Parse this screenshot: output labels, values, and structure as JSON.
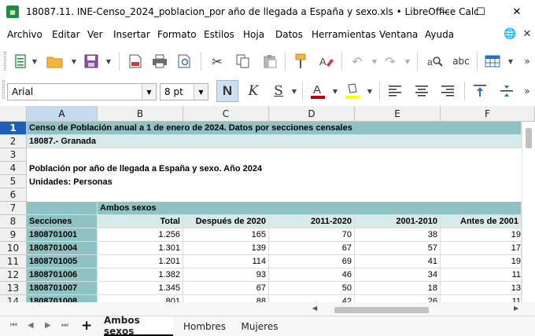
{
  "window": {
    "title": "18087.11. INE-Censo_2024_poblacion_por año de llegada a España y sexo.xls • LibreOffice Calc",
    "app_icon": "calc-app-icon",
    "controls": {
      "minimize": "—",
      "maximize": "☐",
      "close": "✕"
    }
  },
  "menu": {
    "items": [
      "Archivo",
      "Editar",
      "Ver",
      "Insertar",
      "Formato",
      "Estilos",
      "Hoja",
      "Datos",
      "Herramientas",
      "Ventana",
      "Ayuda"
    ],
    "right_icons": [
      "globe-icon",
      "close-document-icon"
    ]
  },
  "toolbar_standard": {
    "icons": [
      "new-spreadsheet-icon",
      "open-folder-icon",
      "save-icon",
      "export-pdf-icon",
      "print-icon",
      "print-preview-icon",
      "cut-icon",
      "copy-icon",
      "paste-icon",
      "clone-formatting-icon",
      "clear-formatting-icon",
      "undo-icon",
      "redo-icon",
      "find-replace-icon",
      "spelling-icon",
      "row-col-icon"
    ]
  },
  "toolbar_formatting": {
    "font_name": "Arial",
    "font_size": "8 pt",
    "bold": "N",
    "italic": "K",
    "underline": "S",
    "font_color": "#c00000",
    "highlight_color": "#ffff00",
    "icons": [
      "font-color-icon",
      "highlight-icon",
      "align-left-icon",
      "align-center-icon",
      "align-right-icon",
      "align-top-icon",
      "align-vcenter-icon"
    ]
  },
  "sheet": {
    "columns": [
      "A",
      "B",
      "C",
      "D",
      "E",
      "F"
    ],
    "selected_column": "A",
    "rows": [
      "1",
      "2",
      "3",
      "4",
      "5",
      "6",
      "7",
      "8",
      "9",
      "10",
      "11",
      "12",
      "13",
      "14"
    ],
    "selected_row": "1",
    "colors": {
      "header_teal": "#8fc3c3",
      "light_teal": "#d7e9ea",
      "row_highlight": "#1e5eb6"
    },
    "cells": {
      "r1": "Censo de Población anual a 1 de enero de 2024. Datos por secciones censales",
      "r2": "18087.- Granada",
      "r4": "Población por año de llegada a España y sexo. Año 2024",
      "r5": "Unidades: Personas",
      "r7b": "Ambos sexos",
      "headers": [
        "Secciones",
        "Total",
        "Después de 2020",
        "2011-2020",
        "2001-2010",
        "Antes de 2001"
      ]
    },
    "data_rows": [
      [
        "1808701001",
        "1.256",
        "165",
        "70",
        "38",
        "19"
      ],
      [
        "1808701004",
        "1.301",
        "139",
        "67",
        "57",
        "17"
      ],
      [
        "1808701005",
        "1.201",
        "114",
        "69",
        "41",
        "19"
      ],
      [
        "1808701006",
        "1.382",
        "93",
        "46",
        "34",
        "11"
      ],
      [
        "1808701007",
        "1.345",
        "67",
        "50",
        "18",
        "13"
      ],
      [
        "1808701008",
        "801",
        "88",
        "42",
        "26",
        "11"
      ]
    ]
  },
  "sheet_tabs": {
    "add_label": "+",
    "tabs": [
      "Ambos sexos",
      "Hombres",
      "Mujeres"
    ],
    "active": "Ambos sexos"
  }
}
